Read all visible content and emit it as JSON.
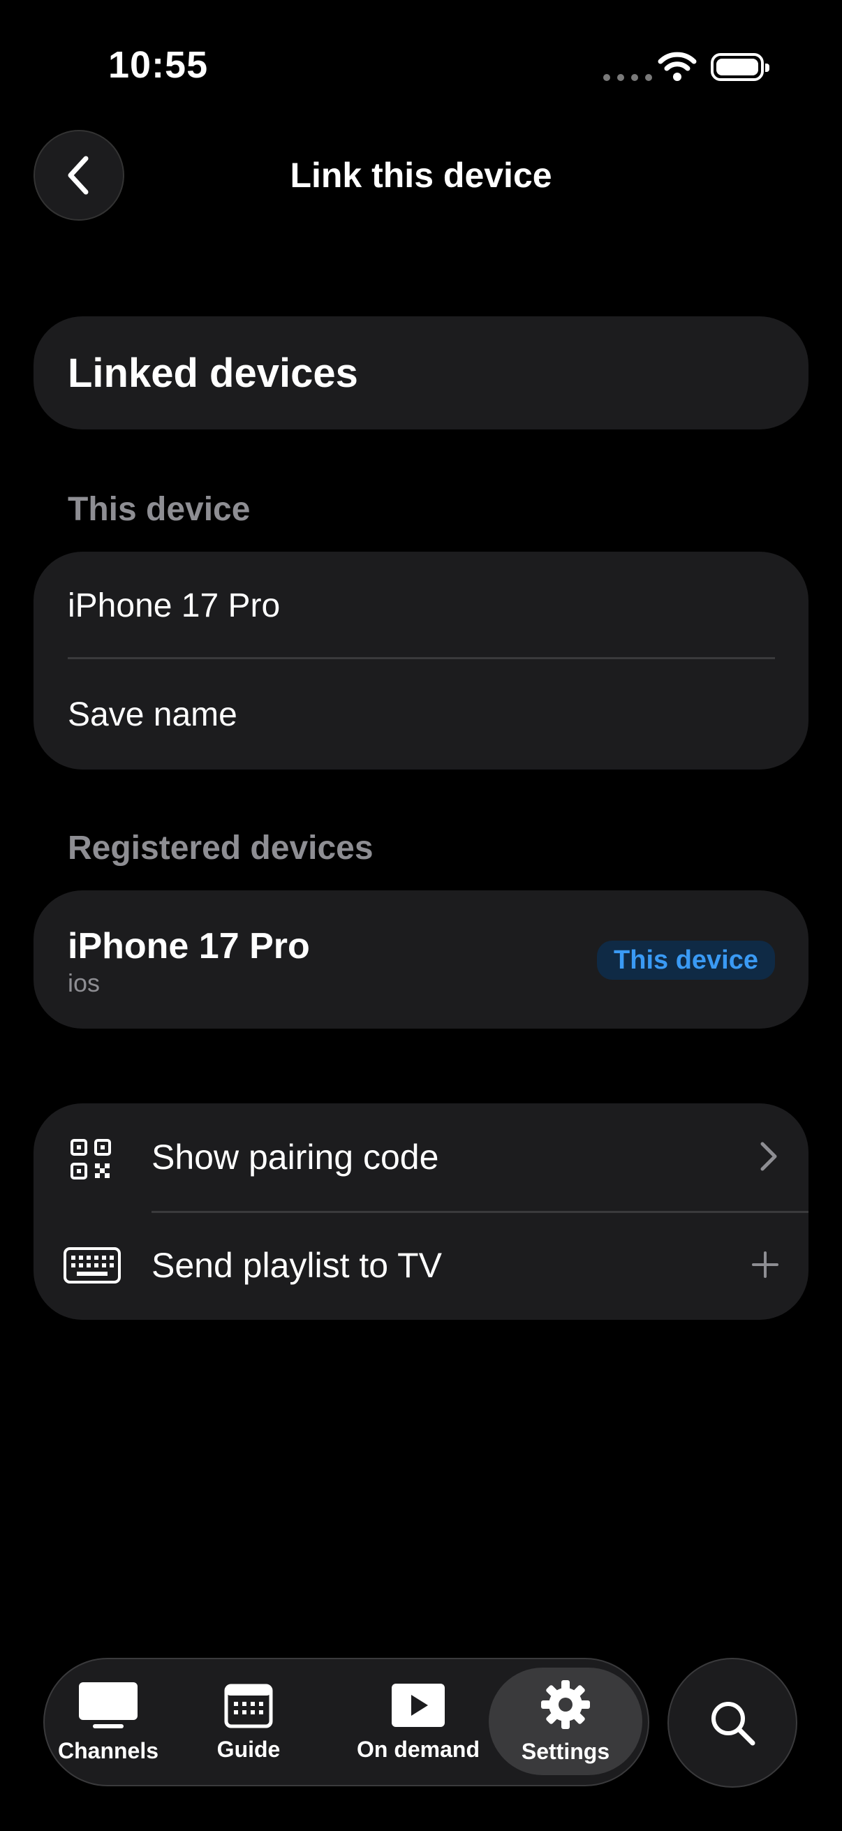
{
  "status_bar": {
    "time": "10:55"
  },
  "header": {
    "title": "Link this device"
  },
  "linked": {
    "title": "Linked devices"
  },
  "this_device": {
    "section_label": "This device",
    "device_name": "iPhone 17 Pro",
    "save_label": "Save name"
  },
  "registered": {
    "section_label": "Registered devices",
    "items": [
      {
        "name": "iPhone 17 Pro",
        "os": "ios",
        "badge": "This device"
      }
    ]
  },
  "actions": [
    {
      "label": "Show pairing code",
      "icon": "qr-code-icon",
      "trailing": "chevron-right-icon"
    },
    {
      "label": "Send playlist to TV",
      "icon": "keyboard-icon",
      "trailing": "plus-icon"
    }
  ],
  "tabs": [
    {
      "label": "Channels",
      "icon": "tv-icon",
      "active": false
    },
    {
      "label": "Guide",
      "icon": "calendar-icon",
      "active": false
    },
    {
      "label": "On demand",
      "icon": "play-icon",
      "active": false
    },
    {
      "label": "Settings",
      "icon": "gear-icon",
      "active": true
    }
  ],
  "colors": {
    "accent": "#3a9af4",
    "card": "#1c1c1e",
    "muted": "#8e8e93"
  }
}
